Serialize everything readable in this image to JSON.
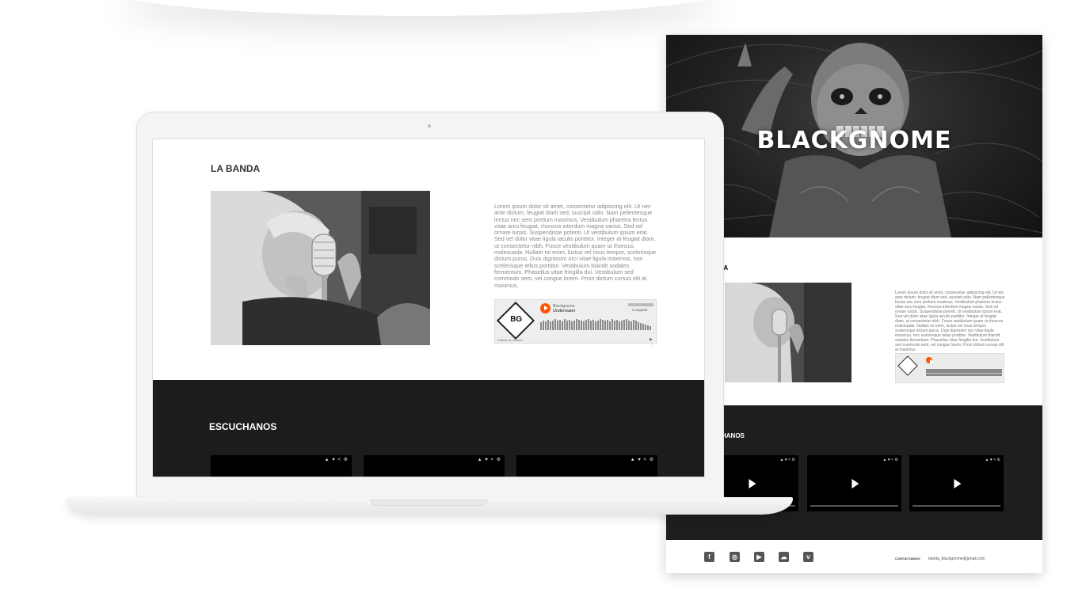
{
  "laptop": {
    "section_band": "LA BANDA",
    "lorem": "Lorem ipsum dolor sit amet, consectetur adipiscing elit. Ut nec ante dictum, feugiat diam sed, suscipit odio. Nam pellentesque lectus nec sem pretium maximus. Vestibulum pharetra lectus vitae arcu feugiat, rhoncus interdum magna varius. Sed vel ornare turpis. Suspendisse potenti. Ut vestibulum ipsum erat. Sed vel dolor vitae ligula iaculis porttitor. Integer at feugiat diam, ut consectetur nibh. Fusce vestibulum quam ut rhoncus malesuada. Nullam mi enim, luctus vel risus tempor, scelerisque dictum purus. Duis dignissim orci vitae ligula maximus, non scelerisque tellus porttitor. Vestibulum blandit sodales fermentum. Phasellus vitae fringilla dui. Vestibulum sed commodo sem, vel congue lorem. Proin dictum cursus elit at maximus.",
    "player": {
      "logo_text": "BG",
      "artist": "Blackgnome",
      "track": "Underwater",
      "share": "Compartir",
      "policy": "Política de cookies"
    },
    "section_listen": "ESCUCHANOS",
    "video_controls": "▲ ♥ < ⚙"
  },
  "page": {
    "hero_logo": "BLACKGNOME",
    "section_band": "ANDA",
    "section_listen": "HANOS",
    "video_controls": "▲ ♥ < ⚙",
    "social_icons": [
      "facebook-icon",
      "instagram-icon",
      "youtube-icon",
      "soundcloud-icon",
      "vimeo-icon"
    ],
    "social_glyphs": [
      "f",
      "◎",
      "▶",
      "☁",
      "v"
    ],
    "contact_label": "CONTÁCTANOS:",
    "contact_email": "banda_blackgnome@gmail.com"
  }
}
